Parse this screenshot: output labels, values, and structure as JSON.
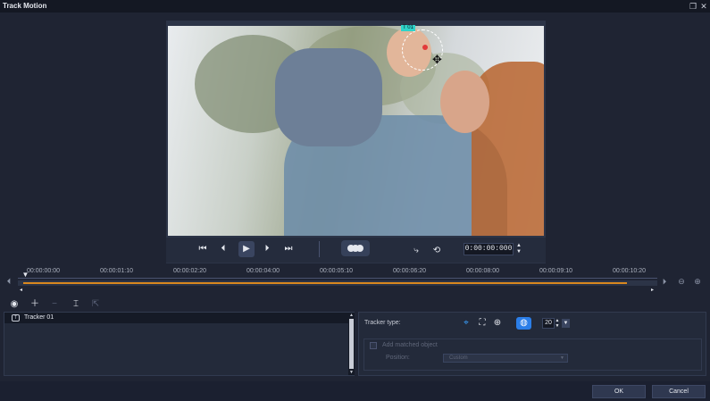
{
  "window": {
    "title": "Track Motion",
    "restore_icon": "restore-window-icon",
    "close_icon": "close-icon"
  },
  "preview": {
    "tracker_tag": "T 01",
    "timecode": "0:00:00:000"
  },
  "timeline": {
    "ticks": [
      "00:00:00:00",
      "00:00:01:10",
      "00:00:02:20",
      "00:00:04:00",
      "00:00:05:10",
      "00:00:06:20",
      "00:00:08:00",
      "00:00:09:10",
      "00:00:10:20"
    ],
    "progress_fraction": 0.96
  },
  "trackers": {
    "items": [
      {
        "name": "Tracker 01"
      }
    ]
  },
  "properties": {
    "tracker_type_label": "Tracker type:",
    "tracker_size": "20",
    "add_matched_object_label": "Add matched object",
    "position_label": "Position:",
    "position_value": "Custom"
  },
  "footer": {
    "ok_label": "OK",
    "cancel_label": "Cancel"
  },
  "colors": {
    "accent": "#2b7ee8",
    "progress": "#d9881f",
    "tracker_dot": "#e23a3a",
    "tracker_tag": "#2fd3c9"
  }
}
